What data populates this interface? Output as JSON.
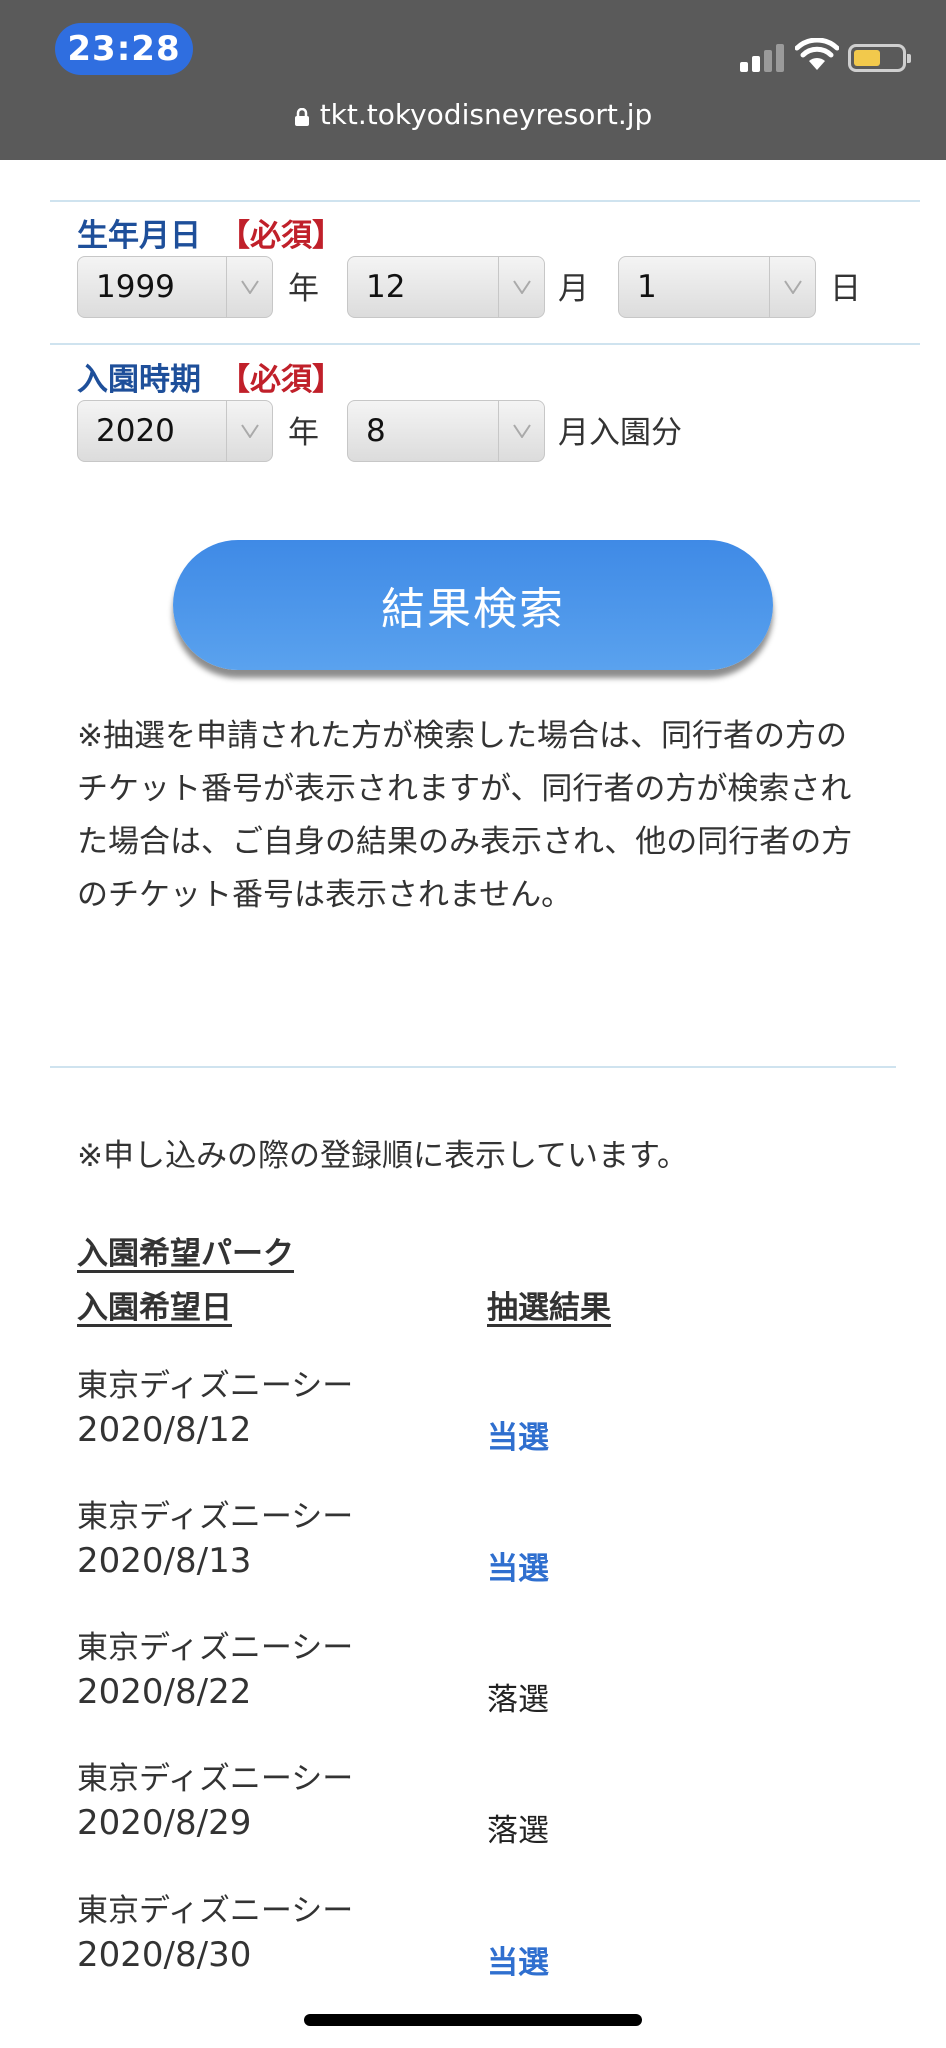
{
  "status_bar": {
    "time": "23:28"
  },
  "browser": {
    "url": "tkt.tokyodisneyresort.jp"
  },
  "form": {
    "birthdate": {
      "label": "生年月日",
      "required": "【必須】",
      "year": "1999",
      "year_unit": "年",
      "month": "12",
      "month_unit": "月",
      "day": "1",
      "day_unit": "日"
    },
    "visit_period": {
      "label": "入園時期",
      "required": "【必須】",
      "year": "2020",
      "year_unit": "年",
      "month": "8",
      "month_unit": "月入園分"
    },
    "search_button": "結果検索"
  },
  "note": "※抽選を申請された方が検索した場合は、同行者の方のチケット番号が表示されますが、同行者の方が検索された場合は、ご自身の結果のみ表示され、他の同行者の方のチケット番号は表示されません。",
  "results": {
    "note": "※申し込みの際の登録順に表示しています。",
    "header_park": "入園希望パーク",
    "header_date": "入園希望日",
    "header_result": "抽選結果",
    "rows": [
      {
        "park": "東京ディズニーシー",
        "date": "2020/8/12",
        "result": "当選"
      },
      {
        "park": "東京ディズニーシー",
        "date": "2020/8/13",
        "result": "当選"
      },
      {
        "park": "東京ディズニーシー",
        "date": "2020/8/22",
        "result": "落選"
      },
      {
        "park": "東京ディズニーシー",
        "date": "2020/8/29",
        "result": "落選"
      },
      {
        "park": "東京ディズニーシー",
        "date": "2020/8/30",
        "result": "当選"
      }
    ]
  },
  "colors": {
    "win": "#2f6fcf",
    "label": "#1e4f9a",
    "required": "#c0202a",
    "button": "#4a90e2"
  }
}
